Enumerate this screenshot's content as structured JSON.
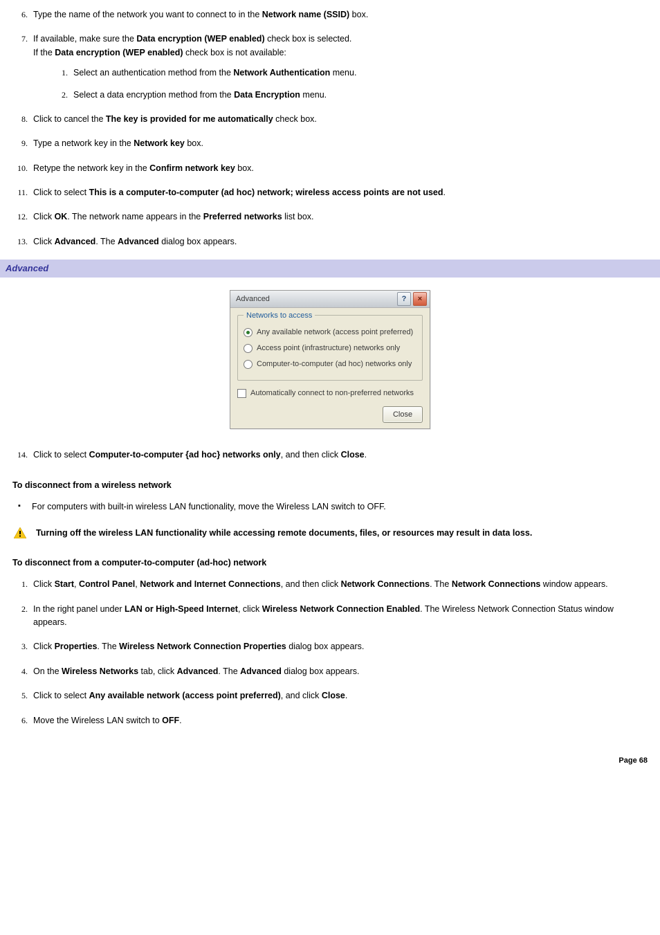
{
  "steps_top": [
    {
      "n": "6.",
      "html": "Type the name of the network you want to connect to in the <b>Network name (SSID)</b> box."
    },
    {
      "n": "7.",
      "html": "If available, make sure the <b>Data encryption (WEP enabled)</b> check box is selected.<br>If the <b>Data encryption (WEP enabled)</b> check box is not available:",
      "sub": [
        {
          "n": "1.",
          "html": "Select an authentication method from the <b>Network Authentication</b> menu."
        },
        {
          "n": "2.",
          "html": "Select a data encryption method from the <b>Data Encryption</b> menu."
        }
      ]
    },
    {
      "n": "8.",
      "html": "Click to cancel the <b>The key is provided for me automatically</b> check box."
    },
    {
      "n": "9.",
      "html": "Type a network key in the <b>Network key</b> box."
    },
    {
      "n": "10.",
      "html": "Retype the network key in the <b>Confirm network key</b> box."
    },
    {
      "n": "11.",
      "html": "Click to select <b>This is a computer-to-computer (ad hoc) network; wireless access points are not used</b>."
    },
    {
      "n": "12.",
      "html": "Click <b>OK</b>. The network name appears in the <b>Preferred networks</b> list box."
    },
    {
      "n": "13.",
      "html": "Click <b>Advanced</b>. The <b>Advanced</b> dialog box appears."
    }
  ],
  "section_header": "Advanced",
  "dialog": {
    "title": "Advanced",
    "help_glyph": "?",
    "close_glyph": "×",
    "group_title": "Networks to access",
    "radios": [
      {
        "label": "Any available network (access point preferred)",
        "selected": true
      },
      {
        "label": "Access point (infrastructure) networks only",
        "selected": false
      },
      {
        "label": "Computer-to-computer (ad hoc) networks only",
        "selected": false
      }
    ],
    "checkbox_label": "Automatically connect to non-preferred networks",
    "close_button": "Close"
  },
  "step14": {
    "n": "14.",
    "html": "Click to select <b>Computer-to-computer {ad hoc} networks only</b>, and then click <b>Close</b>."
  },
  "heading_disconnect_wireless": "To disconnect from a wireless network",
  "bullet_disconnect": "For computers with built-in wireless LAN functionality, move the Wireless LAN switch to OFF.",
  "warning_text": "Turning off the wireless LAN functionality while accessing remote documents, files, or resources may result in data loss.",
  "heading_disconnect_adhoc": "To disconnect from a computer-to-computer (ad-hoc) network",
  "steps_bottom": [
    {
      "n": "1.",
      "html": "Click <b>Start</b>, <b>Control Panel</b>, <b>Network and Internet Connections</b>, and then click <b>Network Connections</b>. The <b>Network Connections</b> window appears."
    },
    {
      "n": "2.",
      "html": "In the right panel under <b>LAN or High-Speed Internet</b>, click <b>Wireless Network Connection Enabled</b>. The Wireless Network Connection Status window appears."
    },
    {
      "n": "3.",
      "html": "Click <b>Properties</b>. The <b>Wireless Network Connection Properties</b> dialog box appears."
    },
    {
      "n": "4.",
      "html": "On the <b>Wireless Networks</b> tab, click <b>Advanced</b>. The <b>Advanced</b> dialog box appears."
    },
    {
      "n": "5.",
      "html": "Click to select <b>Any available network (access point preferred)</b>, and click <b>Close</b>."
    },
    {
      "n": "6.",
      "html": "Move the Wireless LAN switch to <b>OFF</b>."
    }
  ],
  "page_footer": "Page 68"
}
